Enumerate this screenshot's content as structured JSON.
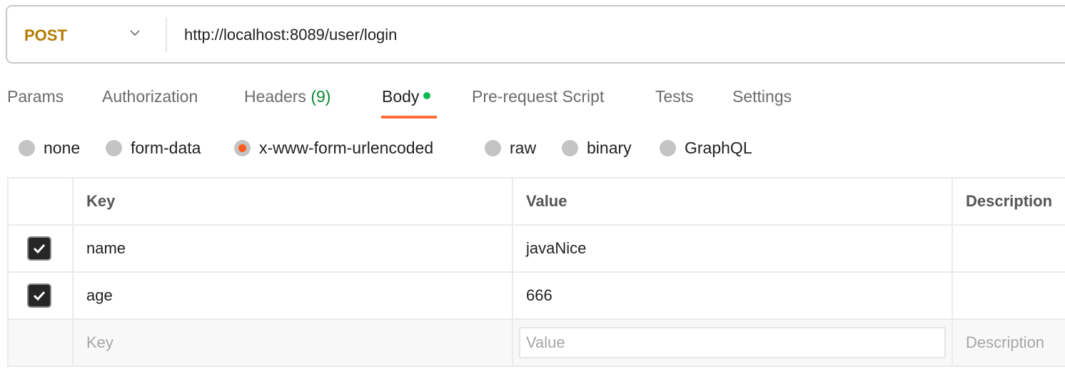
{
  "request": {
    "method": "POST",
    "url": "http://localhost:8089/user/login"
  },
  "tabs": [
    {
      "label": "Params"
    },
    {
      "label": "Authorization"
    },
    {
      "label": "Headers",
      "count": "(9)"
    },
    {
      "label": "Body",
      "active": true
    },
    {
      "label": "Pre-request Script"
    },
    {
      "label": "Tests"
    },
    {
      "label": "Settings"
    }
  ],
  "body_types": [
    {
      "label": "none"
    },
    {
      "label": "form-data"
    },
    {
      "label": "x-www-form-urlencoded",
      "selected": true
    },
    {
      "label": "raw"
    },
    {
      "label": "binary"
    },
    {
      "label": "GraphQL"
    }
  ],
  "table": {
    "headers": {
      "key": "Key",
      "value": "Value",
      "description": "Description"
    },
    "rows": [
      {
        "checked": true,
        "key": "name",
        "value": "javaNice",
        "description": ""
      },
      {
        "checked": true,
        "key": "age",
        "value": "666",
        "description": ""
      }
    ],
    "placeholders": {
      "key": "Key",
      "value": "Value",
      "description": "Description"
    }
  },
  "colors": {
    "method": "#b47a00",
    "active_tab_underline": "#ff6c37",
    "body_dot": "#0cbb52",
    "headers_count": "#0b8a32",
    "radio_selected": "#ff5a1f"
  }
}
